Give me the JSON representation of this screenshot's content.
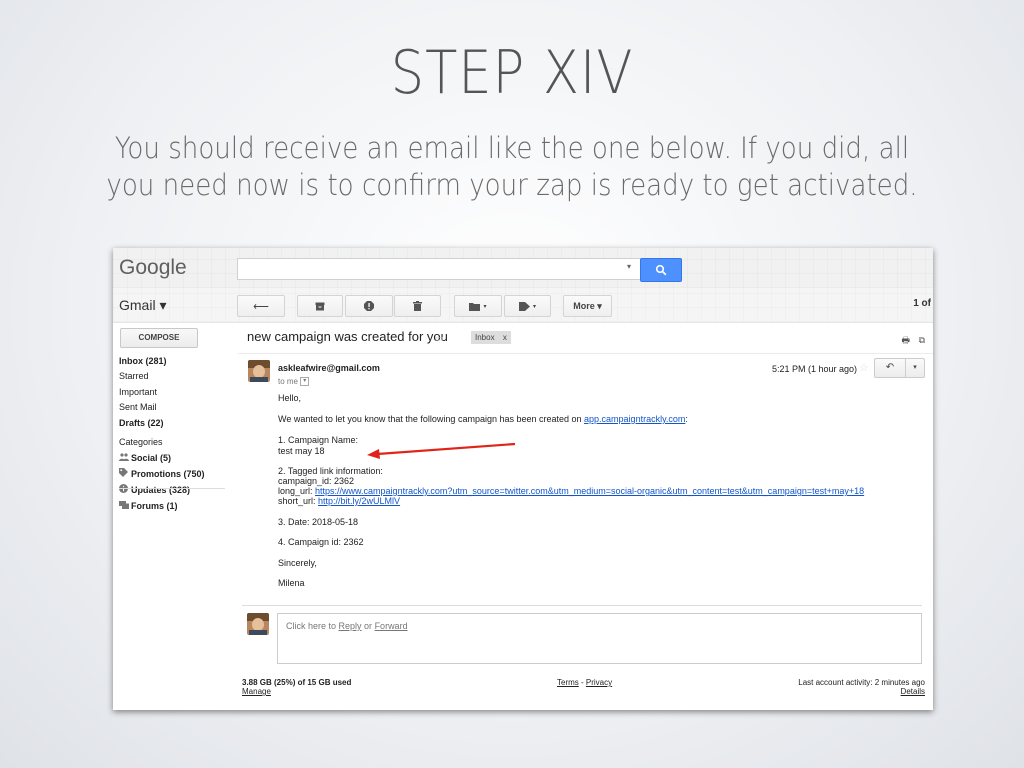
{
  "slide": {
    "title": "STEP XIV",
    "subtitle_line1": "You should receive an email like the one below. If you did, all",
    "subtitle_line2": "you need now is to confirm your zap is ready to get activated."
  },
  "gmail": {
    "logo": "Google",
    "search": {
      "value": "",
      "caret": "▾"
    },
    "app_label": "Gmail ▾",
    "toolbar": {
      "back_icon": "⟵",
      "archive_icon": "archive-icon",
      "spam_icon": "report-spam-icon",
      "delete_icon": "trash-icon",
      "move_icon": "folder-icon",
      "labels_icon": "tag-icon",
      "more_label": "More ▾",
      "page_count": "1 of"
    },
    "sidebar": {
      "compose_label": "COMPOSE",
      "items": [
        {
          "label": "Inbox (281)",
          "bold": true
        },
        {
          "label": "Starred",
          "bold": false
        },
        {
          "label": "Important",
          "bold": false
        },
        {
          "label": "Sent Mail",
          "bold": false
        },
        {
          "label": "Drafts (22)",
          "bold": true
        }
      ],
      "categories_label": "Categories",
      "categories": [
        {
          "icon": "👥",
          "label": "Social (5)"
        },
        {
          "icon": "🏷",
          "label": "Promotions (750)"
        },
        {
          "icon": "ℹ",
          "label": "Updates (328)"
        },
        {
          "icon": "💬",
          "label": "Forums (1)"
        }
      ]
    },
    "thread": {
      "subject": "new campaign was created for you",
      "label": "Inbox",
      "label_close": "x",
      "sender": "askleafwire@gmail.com",
      "to": "to me",
      "time": "5:21 PM (1 hour ago)",
      "reply_icon": "↶",
      "more_icon": "▾",
      "body": {
        "greeting": "Hello,",
        "intro": "We wanted to let you know that the following campaign has been created on ",
        "intro_link": "app.campaigntrackly.com",
        "intro_end": ":",
        "name_heading": "1. Campaign Name:",
        "name_value": "test may 18",
        "tagged_heading": "2. Tagged link information:",
        "campaign_id_line": "campaign_id: 2362",
        "long_url_label": "long_url: ",
        "long_url": "https://www.campaigntrackly.com?utm_source=twitter.com&utm_medium=social-organic&utm_content=test&utm_campaign=test+may+18",
        "short_url_label": "short_url: ",
        "short_url": "http://bit.ly/2wULMlV",
        "date_line": "3. Date: 2018-05-18",
        "id_line": "4. Campaign id: 2362",
        "closing": "Sincerely,",
        "signature": "Milena"
      },
      "reply_prompt": {
        "prefix": "Click here to ",
        "reply": "Reply",
        "middle": " or ",
        "forward": "Forward"
      }
    },
    "footer": {
      "storage": "3.88 GB (25%) of 15 GB used",
      "manage": "Manage",
      "terms": "Terms",
      "separator": " - ",
      "privacy": "Privacy",
      "activity": "Last account activity: 2 minutes ago",
      "details": "Details"
    }
  },
  "colors": {
    "accent_blue": "#4d90fe",
    "link": "#1155cc",
    "annotation_arrow": "#e02418"
  }
}
